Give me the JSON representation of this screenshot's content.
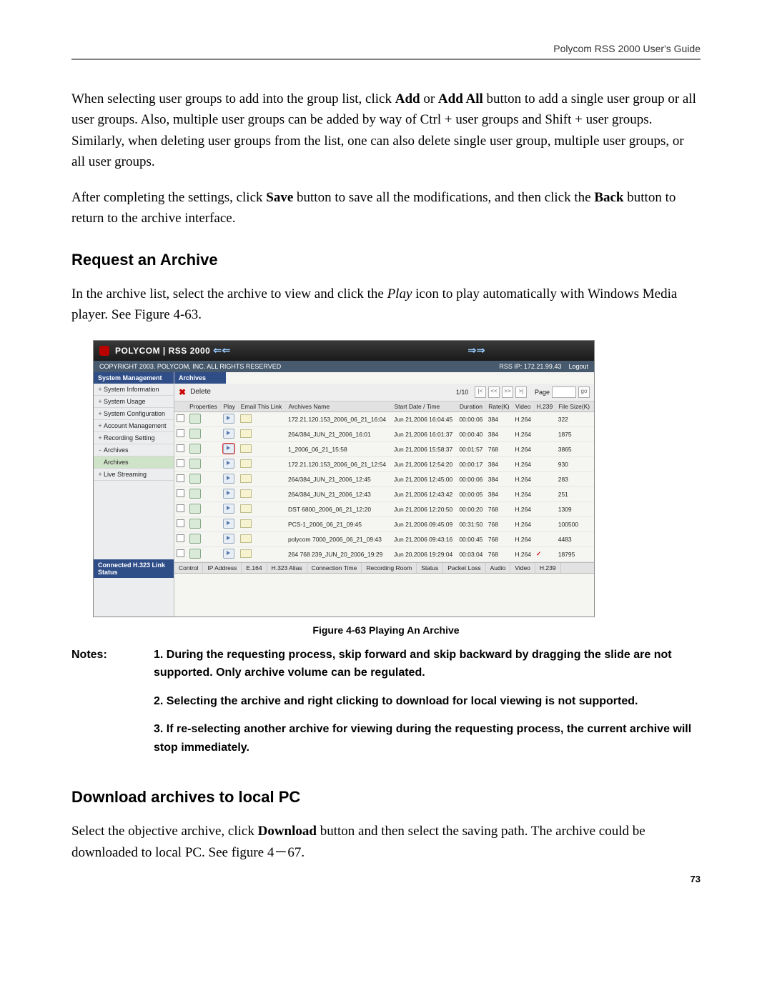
{
  "header": {
    "right": "Polycom RSS 2000 User's Guide"
  },
  "para1a": "When selecting user groups to add into the group list, click ",
  "para1b": " or ",
  "para1c": " button to add a single user group or all user groups. Also, multiple user groups can be added by way of Ctrl + user groups and Shift + user groups. Similarly, when deleting user groups from the list, one can also delete single user group, multiple user groups, or all user groups.",
  "add": "Add",
  "addAll": "Add All",
  "para2a": "After completing the settings, click ",
  "para2b": " button to save all the modifications, and then click the ",
  "para2c": " button to return to the archive interface.",
  "save": "Save",
  "back": "Back",
  "sec1": "Request an Archive",
  "para3a": "In the archive list, select the archive to view and click the ",
  "play_i": "Play",
  "para3b": " icon to play automatically with Windows Media player. See Figure 4-63.",
  "figcap": "Figure 4-63 Playing An Archive",
  "notesLabel": "Notes:",
  "note1": "1.   During the requesting process, skip forward and skip backward by dragging the slide are not supported. Only archive volume can be regulated.",
  "note2": "2.   Selecting the archive and right clicking to download for local viewing is not supported.",
  "note3": "3.   If re-selecting another archive for viewing during the requesting process, the current archive will stop immediately.",
  "sec2": "Download archives to local PC",
  "para4a": "Select the objective archive, click ",
  "download": "Download",
  "para4b": " button and then select the saving path. The archive could be downloaded to local PC. See figure 4－67.",
  "pagenum": "73",
  "shot": {
    "title": "POLYCOM | RSS 2000",
    "subLeft": "COPYRIGHT 2003. POLYCOM, INC. ALL RIGHTS RESERVED",
    "subRight1": "RSS IP: 172.21.99.43",
    "subRight2": "Logout",
    "sideHeader": "System Management",
    "sideItems": [
      {
        "exp": "+",
        "label": "System Information"
      },
      {
        "exp": "+",
        "label": "System Usage"
      },
      {
        "exp": "+",
        "label": "System Configuration"
      },
      {
        "exp": "+",
        "label": "Account Management"
      },
      {
        "exp": "+",
        "label": "Recording Setting"
      },
      {
        "exp": "-",
        "label": "Archives"
      },
      {
        "exp": "",
        "label": "Archives",
        "sel": true
      },
      {
        "exp": "+",
        "label": "Live Streaming"
      }
    ],
    "mainTab": "Archives",
    "toolbar": {
      "delete": "Delete",
      "pageInfo": "1/10",
      "pageLabel": "Page",
      "goLabel": "go"
    },
    "columns": [
      "",
      "Properties",
      "Play",
      "Email This Link",
      "Archives Name",
      "Start Date / Time",
      "Duration",
      "Rate(K)",
      "Video",
      "H.239",
      "File Size(K)"
    ],
    "rows": [
      {
        "name": "172.21.120.153_2006_06_21_16:04",
        "start": "Jun 21,2006 16:04:45",
        "dur": "00:00:06",
        "rate": "384",
        "video": "H.264",
        "h239": "",
        "size": "322"
      },
      {
        "name": "264/384_JUN_21_2006_16:01",
        "start": "Jun 21,2006 16:01:37",
        "dur": "00:00:40",
        "rate": "384",
        "video": "H.264",
        "h239": "",
        "size": "1875"
      },
      {
        "name": "1_2006_06_21_15:58",
        "start": "Jun 21,2006 15:58:37",
        "dur": "00:01:57",
        "rate": "768",
        "video": "H.264",
        "h239": "",
        "size": "3865",
        "hotplay": true
      },
      {
        "name": "172.21.120.153_2006_06_21_12:54",
        "start": "Jun 21,2006 12:54:20",
        "dur": "00:00:17",
        "rate": "384",
        "video": "H.264",
        "h239": "",
        "size": "930"
      },
      {
        "name": "264/384_JUN_21_2006_12:45",
        "start": "Jun 21,2006 12:45:00",
        "dur": "00:00:06",
        "rate": "384",
        "video": "H.264",
        "h239": "",
        "size": "283"
      },
      {
        "name": "264/384_JUN_21_2006_12:43",
        "start": "Jun 21,2006 12:43:42",
        "dur": "00:00:05",
        "rate": "384",
        "video": "H.264",
        "h239": "",
        "size": "251"
      },
      {
        "name": "DST 6800_2006_06_21_12:20",
        "start": "Jun 21,2006 12:20:50",
        "dur": "00:00:20",
        "rate": "768",
        "video": "H.264",
        "h239": "",
        "size": "1309"
      },
      {
        "name": "PCS-1_2006_06_21_09:45",
        "start": "Jun 21,2006 09:45:09",
        "dur": "00:31:50",
        "rate": "768",
        "video": "H.264",
        "h239": "",
        "size": "100500"
      },
      {
        "name": "polycom 7000_2006_06_21_09:43",
        "start": "Jun 21,2006 09:43:16",
        "dur": "00:00:45",
        "rate": "768",
        "video": "H.264",
        "h239": "",
        "size": "4483"
      },
      {
        "name": "264 768 239_JUN_20_2006_19:29",
        "start": "Jun 20,2006 19:29:04",
        "dur": "00:03:04",
        "rate": "768",
        "video": "H.264",
        "h239": "✓",
        "size": "18795"
      }
    ],
    "linkStatus": "Connected H.323 Link Status",
    "statusCols": [
      "Control",
      "IP Address",
      "E.164",
      "H.323 Alias",
      "Connection Time",
      "Recording Room",
      "Status",
      "Packet Loss",
      "Audio",
      "Video",
      "H.239"
    ]
  }
}
